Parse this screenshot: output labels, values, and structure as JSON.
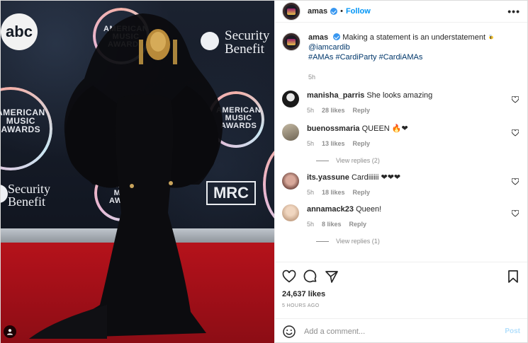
{
  "header": {
    "username": "amas",
    "separator": "•",
    "follow_label": "Follow",
    "more_label": "•••"
  },
  "photo": {
    "ring_text_1": "AMERICAN\nMUSIC\nAWARDS",
    "abc_logo": "abc",
    "security_benefit_1": "Security\nBenefit",
    "mrc_logo": "MRC",
    "alt": "Person in a black gown with a gold face mask on the red carpet at the American Music Awards"
  },
  "caption": {
    "username": "amas",
    "text": "Making a statement is an understatement",
    "mention": "@iamcardib",
    "hashtags": "#AMAs #CardiParty #CardiAMAs",
    "time": "5h"
  },
  "comments": [
    {
      "username": "manisha_parris",
      "text": "She looks amazing",
      "time": "5h",
      "likes": "28 likes",
      "reply": "Reply"
    },
    {
      "username": "buenossmaria",
      "text": "QUEEN 🔥❤",
      "time": "5h",
      "likes": "13 likes",
      "reply": "Reply",
      "view_replies": "View replies (2)"
    },
    {
      "username": "its.yassune",
      "text": "Cardiiiiii ❤❤❤",
      "time": "5h",
      "likes": "18 likes",
      "reply": "Reply"
    },
    {
      "username": "annamack23",
      "text": "Queen!",
      "time": "5h",
      "likes": "8 likes",
      "reply": "Reply",
      "view_replies": "View replies (1)"
    }
  ],
  "actions": {
    "likes": "24,637 likes",
    "ago": "5 HOURS AGO"
  },
  "add_comment": {
    "placeholder": "Add a comment...",
    "post_label": "Post"
  },
  "colors": {
    "accent": "#0095f6",
    "verified": "#3897f0",
    "muted": "#8e8e8e",
    "carpet": "#b5121b"
  }
}
